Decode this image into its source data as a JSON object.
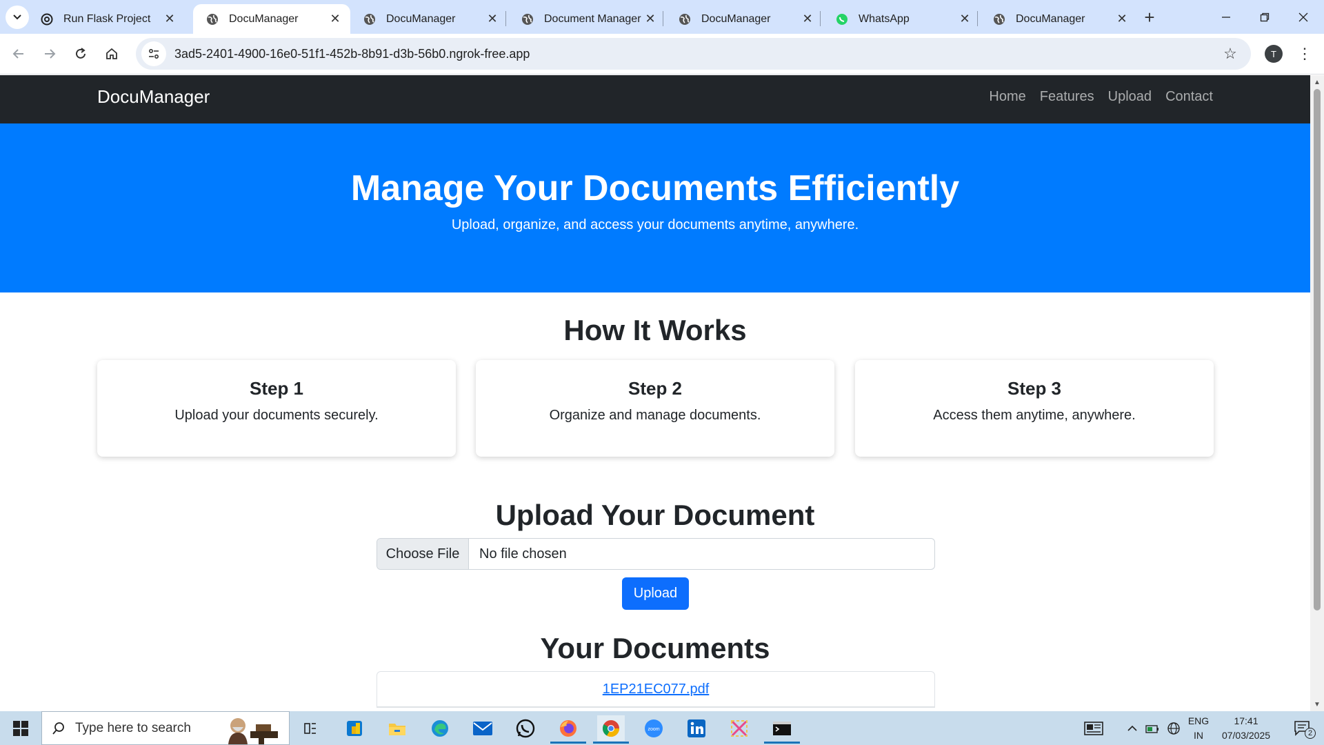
{
  "browser": {
    "tabs": [
      {
        "title": "Run Flask Project",
        "icon": "openai-icon"
      },
      {
        "title": "DocuManager",
        "icon": "globe-icon",
        "active": true
      },
      {
        "title": "DocuManager",
        "icon": "globe-icon"
      },
      {
        "title": "Document Manager",
        "icon": "globe-icon"
      },
      {
        "title": "DocuManager",
        "icon": "globe-icon"
      },
      {
        "title": "WhatsApp",
        "icon": "whatsapp-icon"
      },
      {
        "title": "DocuManager",
        "icon": "globe-icon"
      }
    ],
    "url": "3ad5-2401-4900-16e0-51f1-452b-8b91-d3b-56b0.ngrok-free.app",
    "profile_initial": "T"
  },
  "site": {
    "brand": "DocuManager",
    "nav": [
      "Home",
      "Features",
      "Upload",
      "Contact"
    ],
    "hero": {
      "title": "Manage Your Documents Efficiently",
      "subtitle": "Upload, organize, and access your documents anytime, anywhere."
    },
    "how_it_works": {
      "title": "How It Works",
      "steps": [
        {
          "title": "Step 1",
          "text": "Upload your documents securely."
        },
        {
          "title": "Step 2",
          "text": "Organize and manage documents."
        },
        {
          "title": "Step 3",
          "text": "Access them anytime, anywhere."
        }
      ]
    },
    "upload": {
      "title": "Upload Your Document",
      "choose_label": "Choose File",
      "file_status": "No file chosen",
      "button": "Upload"
    },
    "documents": {
      "title": "Your Documents",
      "items": [
        "1EP21EC077.pdf"
      ]
    }
  },
  "taskbar": {
    "search_placeholder": "Type here to search",
    "lang_line1": "ENG",
    "lang_line2": "IN",
    "time": "17:41",
    "date": "07/03/2025",
    "notifications": "2"
  },
  "colors": {
    "hero_bg": "#007bff",
    "navbar_bg": "#212529",
    "primary_button": "#0d6efd",
    "tabstrip_bg": "#d3e3fd"
  }
}
